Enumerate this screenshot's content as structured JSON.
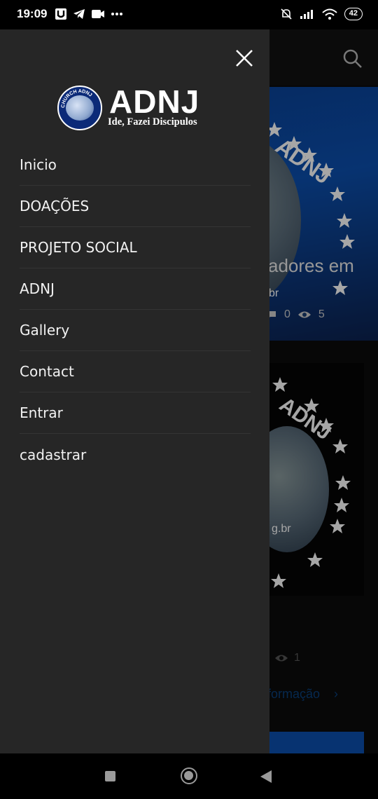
{
  "status_bar": {
    "time": "19:09",
    "battery": "42",
    "icons_left": [
      "u-app-icon",
      "telegram-icon",
      "video-icon",
      "more-dots-icon"
    ],
    "icons_right": [
      "mute-icon",
      "signal-icon",
      "wifi-icon",
      "battery-icon"
    ]
  },
  "drawer": {
    "logo": {
      "name": "ADNJ",
      "slogan": "Ide, Fazei Discipulos",
      "seal_text": "CHURCH ADNJ"
    },
    "menu": [
      {
        "label": "Inicio"
      },
      {
        "label": "DOAÇÕES"
      },
      {
        "label": "PROJETO SOCIAL"
      },
      {
        "label": "ADNJ"
      },
      {
        "label": "Gallery"
      },
      {
        "label": "Contact"
      },
      {
        "label": "Entrar"
      },
      {
        "label": "cadastrar"
      }
    ]
  },
  "background": {
    "card1_title_fragment": "adores em",
    "card1_comments": "0",
    "card1_views": "5",
    "card1_url_fragment": "br",
    "card2_url_fragment": "g.br",
    "card2_views": "1",
    "card2_link_fragment": "formação"
  },
  "colors": {
    "drawer_bg": "#262626",
    "accent_blue": "#0b4fae",
    "text": "#f2f2f2"
  }
}
